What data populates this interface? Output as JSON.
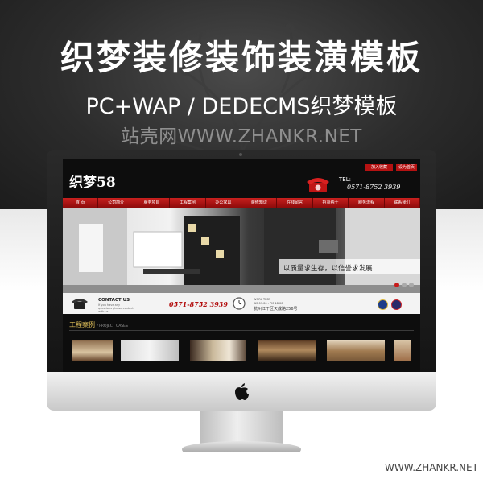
{
  "banner": {
    "title": "织梦装修装饰装潢模板",
    "subtitle": "PC+WAP / DEDECMS织梦模板",
    "site": "站壳网WWW.ZHANKR.NET"
  },
  "screen": {
    "logo": "织梦58",
    "top_buttons": [
      "加入收藏",
      "设为首页"
    ],
    "tel_label": "TEL:",
    "tel_number": "0571-8752 3939",
    "nav": [
      "首 页",
      "公司简介",
      "服务项目",
      "工程案例",
      "办公家具",
      "装修知识",
      "在线留言",
      "招贤纳士",
      "服务流程",
      "联系我们"
    ],
    "slogan": "以质量求生存，以信誉求发展",
    "contact": {
      "title": "CONTACT US",
      "desc": "If you have any questions please contact with us",
      "number": "0571-8752 3939"
    },
    "work_time": {
      "title": "WORK TIME",
      "hours": "AM 09:00 - PM 18:00",
      "address": "杭州江干区天成路256号"
    },
    "cases": {
      "title_cn": "工程案例",
      "title_en": "/ PROJECT CASES"
    }
  },
  "watermark": "WWW.ZHANKR.NET",
  "colors": {
    "nav_red": "#b51212",
    "accent_gold": "#e3c25a",
    "banner_dark": "#2c2c2c"
  },
  "icons": [
    "phone-icon",
    "clock-icon",
    "apple-logo-icon"
  ]
}
